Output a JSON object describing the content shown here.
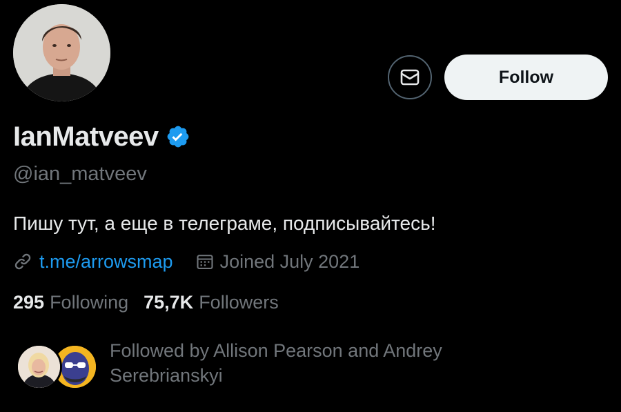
{
  "profile": {
    "display_name": "IanMatveev",
    "handle": "@ian_matveev",
    "bio": "Пишу тут, а еще в телеграме, подписывайтесь!",
    "link": "t.me/arrowsmap",
    "joined": "Joined July 2021",
    "verified": true
  },
  "actions": {
    "follow_label": "Follow",
    "message_icon": "envelope-icon"
  },
  "stats": {
    "following_count": "295",
    "following_label": "Following",
    "followers_count": "75,7K",
    "followers_label": "Followers"
  },
  "followed_by": {
    "text": "Followed by Allison Pearson and Andrey Serebrianskyi"
  },
  "colors": {
    "background": "#000000",
    "primary_text": "#e7e9ea",
    "secondary_text": "#71767b",
    "link": "#1d9bf0",
    "verified_badge": "#1d9bf0",
    "follow_button_bg": "#eff3f4"
  }
}
